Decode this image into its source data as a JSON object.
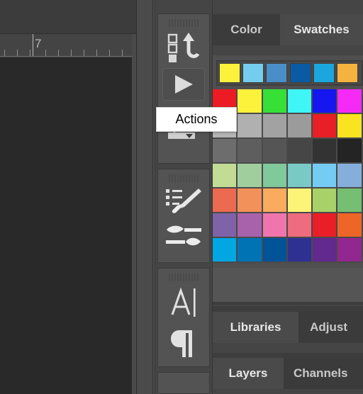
{
  "app": {
    "theme": "dark",
    "bg_color": "#454545",
    "canvas_color": "#292929"
  },
  "document_area": {
    "ruler": {
      "label": "7",
      "unit_ticks": 11,
      "major_tick_index": 4
    }
  },
  "icon_dock": {
    "collapse_icon": "double-chevron-left-icon",
    "groups": [
      {
        "name": "actions-group",
        "items": [
          {
            "icon": "history-actions-icon",
            "label": "History / Actions"
          },
          {
            "icon": "play-button-icon",
            "label": "Play"
          },
          {
            "icon": "3d-object-icon",
            "label": "3D"
          }
        ]
      },
      {
        "name": "brushes-group",
        "items": [
          {
            "icon": "brushes-list-icon",
            "label": "Brushes"
          },
          {
            "icon": "brush-settings-icon",
            "label": "Brush Settings"
          }
        ]
      },
      {
        "name": "type-group",
        "items": [
          {
            "icon": "character-a-icon",
            "label": "Character"
          },
          {
            "icon": "paragraph-pilcrow-icon",
            "label": "Paragraph"
          }
        ]
      }
    ]
  },
  "tooltip": {
    "visible": true,
    "text": "Actions"
  },
  "panels": {
    "color_group": {
      "tabs": [
        {
          "label": "Color",
          "active": false
        },
        {
          "label": "Swatches",
          "active": true
        }
      ]
    },
    "libraries_group": {
      "tabs": [
        {
          "label": "Libraries",
          "active": true
        },
        {
          "label": "Adjust",
          "active": false
        }
      ]
    },
    "layers_group": {
      "tabs": [
        {
          "label": "Layers",
          "active": true
        },
        {
          "label": "Channels",
          "active": false
        }
      ]
    }
  },
  "swatches": {
    "recent_strip": [
      "#fdf23b",
      "#74cdee",
      "#4a8ec8",
      "#0a5ba3",
      "#1ba7dd",
      "#f4b23f"
    ],
    "grid": [
      [
        "#ed1c24",
        "#fdf23b",
        "#36e037",
        "#3ff5f5",
        "#1516f0",
        "#f62af6"
      ],
      [
        "#b5b5b5",
        "#b0b0b0",
        "#a2a2a2",
        "#9b9b9b",
        "#e81f26",
        "#fae321"
      ],
      [
        "#6d6d6d",
        "#5e5e5e",
        "#555555",
        "#464646",
        "#333333",
        "#242424"
      ],
      [
        "#c2dc96",
        "#a0ce9d",
        "#7fc99b",
        "#79c9c6",
        "#74ccf4",
        "#86aedb"
      ],
      [
        "#ec6a4f",
        "#f29159",
        "#f9ab5e",
        "#fcf477",
        "#a9d169",
        "#75be72"
      ],
      [
        "#8062a8",
        "#a862ab",
        "#f075ad",
        "#ef6c7e",
        "#ea1e26",
        "#ed6627"
      ],
      [
        "#00a7e3",
        "#0073b5",
        "#015398",
        "#2e3192",
        "#62298e",
        "#92278f"
      ]
    ]
  }
}
